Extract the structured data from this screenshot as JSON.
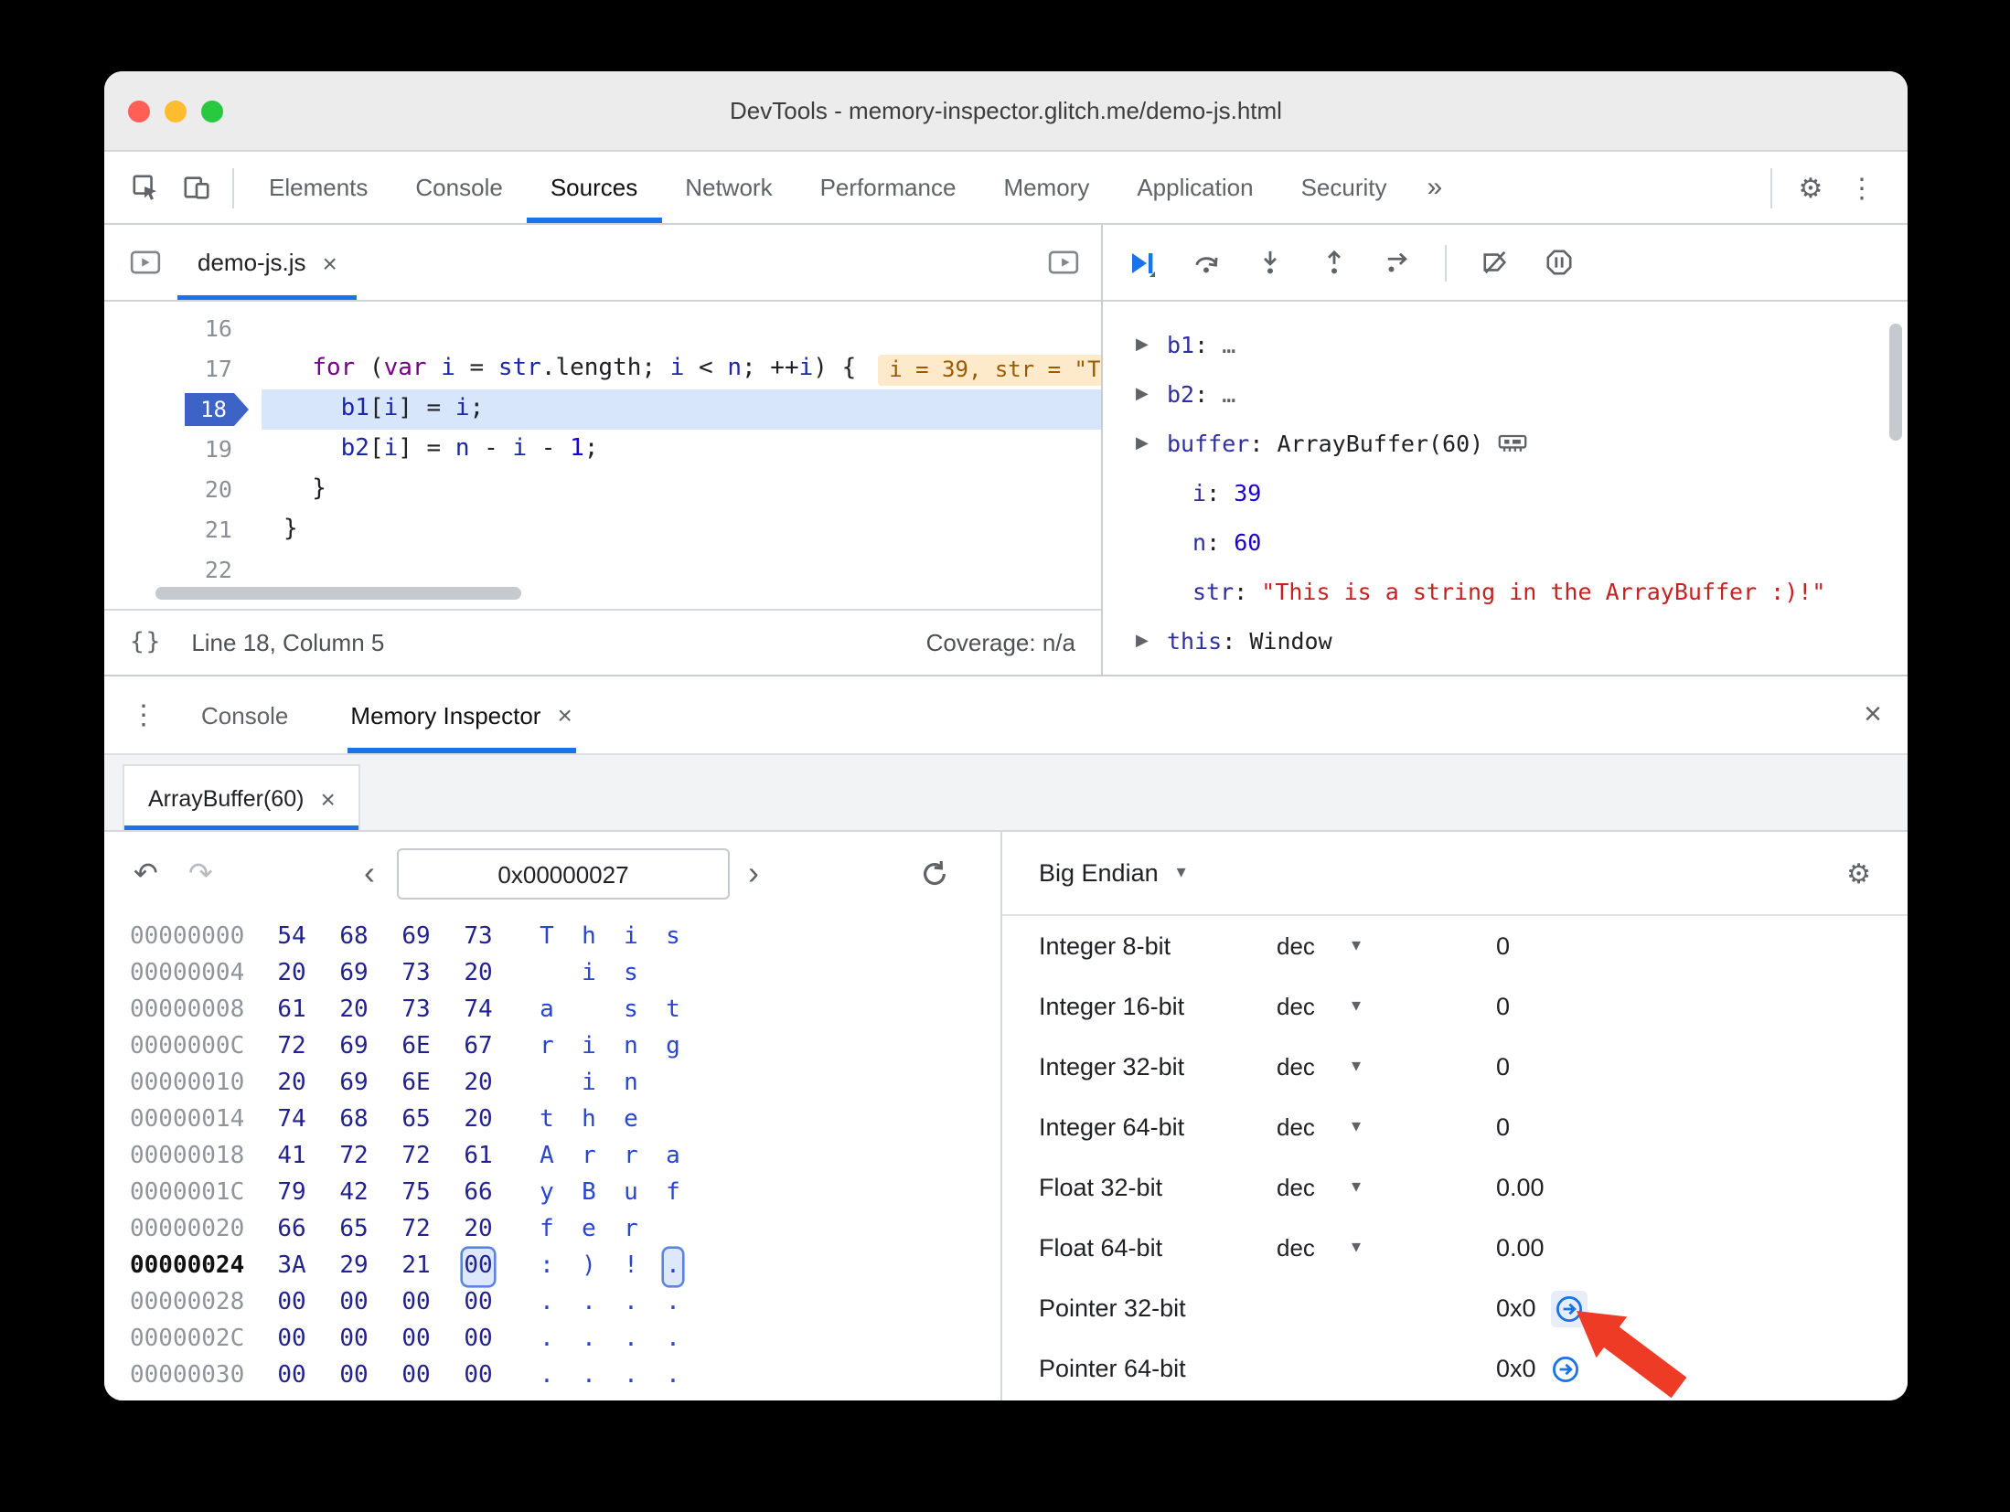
{
  "colors": {
    "accent": "#1a73e8",
    "annotation_arrow": "#ee3b26",
    "execution_line": "#d7e6fb",
    "hint_bg": "#fdeacb",
    "breakpoint_badge": "#3e63c6"
  },
  "icons": {
    "gear": "⚙",
    "kebab": "⋮",
    "close": "×",
    "caret": "▾",
    "triangle": "▶",
    "prev": "‹",
    "next": "›",
    "undo": "↶",
    "redo": "↷",
    "braces": "{}"
  },
  "window": {
    "title": "DevTools - memory-inspector.glitch.me/demo-js.html"
  },
  "toolbar": {
    "tabs": [
      {
        "label": "Elements"
      },
      {
        "label": "Console"
      },
      {
        "label": "Sources",
        "active": true
      },
      {
        "label": "Network"
      },
      {
        "label": "Performance"
      },
      {
        "label": "Memory"
      },
      {
        "label": "Application"
      },
      {
        "label": "Security"
      }
    ],
    "more": "»"
  },
  "sources": {
    "file_tab": "demo-js.js",
    "lines": [
      {
        "num": "16",
        "tokens": []
      },
      {
        "num": "17",
        "tokens": [
          {
            "t": "  "
          },
          {
            "t": "for",
            "c": "kw"
          },
          {
            "t": " ("
          },
          {
            "t": "var",
            "c": "kw"
          },
          {
            "t": " "
          },
          {
            "t": "i",
            "c": "var"
          },
          {
            "t": " = "
          },
          {
            "t": "str",
            "c": "var"
          },
          {
            "t": "."
          },
          {
            "t": "length",
            "c": "prop"
          },
          {
            "t": "; "
          },
          {
            "t": "i",
            "c": "var"
          },
          {
            "t": " < "
          },
          {
            "t": "n",
            "c": "var"
          },
          {
            "t": "; ++"
          },
          {
            "t": "i",
            "c": "var"
          },
          {
            "t": ") {"
          }
        ],
        "hint": "i = 39, str = \"T"
      },
      {
        "num": "18",
        "current": true,
        "tokens": [
          {
            "t": "    "
          },
          {
            "t": "b1",
            "c": "var"
          },
          {
            "t": "["
          },
          {
            "t": "i",
            "c": "var"
          },
          {
            "t": "] = "
          },
          {
            "t": "i",
            "c": "var"
          },
          {
            "t": ";"
          }
        ]
      },
      {
        "num": "19",
        "tokens": [
          {
            "t": "    "
          },
          {
            "t": "b2",
            "c": "var"
          },
          {
            "t": "["
          },
          {
            "t": "i",
            "c": "var"
          },
          {
            "t": "] = "
          },
          {
            "t": "n",
            "c": "var"
          },
          {
            "t": " - "
          },
          {
            "t": "i",
            "c": "var"
          },
          {
            "t": " - "
          },
          {
            "t": "1",
            "c": "num"
          },
          {
            "t": ";"
          }
        ]
      },
      {
        "num": "20",
        "tokens": [
          {
            "t": "  }"
          }
        ]
      },
      {
        "num": "21",
        "tokens": [
          {
            "t": "}"
          }
        ]
      },
      {
        "num": "22",
        "tokens": []
      }
    ],
    "status": {
      "position": "Line 18, Column 5",
      "coverage": "Coverage: n/a"
    }
  },
  "debugger": {
    "scope": [
      {
        "arrow": true,
        "name": "b1",
        "value": "…",
        "vtype": "dots"
      },
      {
        "arrow": true,
        "name": "b2",
        "value": "…",
        "vtype": "dots"
      },
      {
        "arrow": true,
        "name": "buffer",
        "value": "ArrayBuffer(60)",
        "vtype": "plain",
        "icon": "memory"
      },
      {
        "name": "i",
        "value": "39",
        "vtype": "num"
      },
      {
        "name": "n",
        "value": "60",
        "vtype": "num"
      },
      {
        "name": "str",
        "value": "\"This is a string in the ArrayBuffer :)!\"",
        "vtype": "str"
      },
      {
        "arrow": true,
        "name": "this",
        "value": "Window",
        "vtype": "plain"
      }
    ]
  },
  "drawer": {
    "console_tab": "Console",
    "memory_tab": "Memory Inspector"
  },
  "memory": {
    "buffer_tab": "ArrayBuffer(60)",
    "address_value": "0x00000027",
    "endian": "Big Endian",
    "rows": [
      {
        "addr": "00000000",
        "bytes": [
          "54",
          "68",
          "69",
          "73"
        ],
        "ascii": [
          "T",
          "h",
          "i",
          "s"
        ]
      },
      {
        "addr": "00000004",
        "bytes": [
          "20",
          "69",
          "73",
          "20"
        ],
        "ascii": [
          " ",
          "i",
          "s",
          " "
        ]
      },
      {
        "addr": "00000008",
        "bytes": [
          "61",
          "20",
          "73",
          "74"
        ],
        "ascii": [
          "a",
          " ",
          "s",
          "t"
        ]
      },
      {
        "addr": "0000000C",
        "bytes": [
          "72",
          "69",
          "6E",
          "67"
        ],
        "ascii": [
          "r",
          "i",
          "n",
          "g"
        ]
      },
      {
        "addr": "00000010",
        "bytes": [
          "20",
          "69",
          "6E",
          "20"
        ],
        "ascii": [
          " ",
          "i",
          "n",
          " "
        ]
      },
      {
        "addr": "00000014",
        "bytes": [
          "74",
          "68",
          "65",
          "20"
        ],
        "ascii": [
          "t",
          "h",
          "e",
          " "
        ]
      },
      {
        "addr": "00000018",
        "bytes": [
          "41",
          "72",
          "72",
          "61"
        ],
        "ascii": [
          "A",
          "r",
          "r",
          "a"
        ]
      },
      {
        "addr": "0000001C",
        "bytes": [
          "79",
          "42",
          "75",
          "66"
        ],
        "ascii": [
          "y",
          "B",
          "u",
          "f"
        ]
      },
      {
        "addr": "00000020",
        "bytes": [
          "66",
          "65",
          "72",
          "20"
        ],
        "ascii": [
          "f",
          "e",
          "r",
          " "
        ]
      },
      {
        "addr": "00000024",
        "bytes": [
          "3A",
          "29",
          "21",
          "00"
        ],
        "ascii": [
          ":",
          ")",
          "!",
          "."
        ],
        "current": true,
        "selected_col": 3
      },
      {
        "addr": "00000028",
        "bytes": [
          "00",
          "00",
          "00",
          "00"
        ],
        "ascii": [
          ".",
          ".",
          ".",
          "."
        ]
      },
      {
        "addr": "0000002C",
        "bytes": [
          "00",
          "00",
          "00",
          "00"
        ],
        "ascii": [
          ".",
          ".",
          ".",
          "."
        ]
      },
      {
        "addr": "00000030",
        "bytes": [
          "00",
          "00",
          "00",
          "00"
        ],
        "ascii": [
          ".",
          ".",
          ".",
          "."
        ]
      }
    ],
    "interpreter": [
      {
        "label": "Integer 8-bit",
        "mode": "dec",
        "value": "0"
      },
      {
        "label": "Integer 16-bit",
        "mode": "dec",
        "value": "0"
      },
      {
        "label": "Integer 32-bit",
        "mode": "dec",
        "value": "0"
      },
      {
        "label": "Integer 64-bit",
        "mode": "dec",
        "value": "0"
      },
      {
        "label": "Float 32-bit",
        "mode": "dec",
        "value": "0.00"
      },
      {
        "label": "Float 64-bit",
        "mode": "dec",
        "value": "0.00"
      },
      {
        "label": "Pointer 32-bit",
        "value": "0x0",
        "jump": true,
        "highlight": true
      },
      {
        "label": "Pointer 64-bit",
        "value": "0x0",
        "jump": true
      }
    ]
  }
}
